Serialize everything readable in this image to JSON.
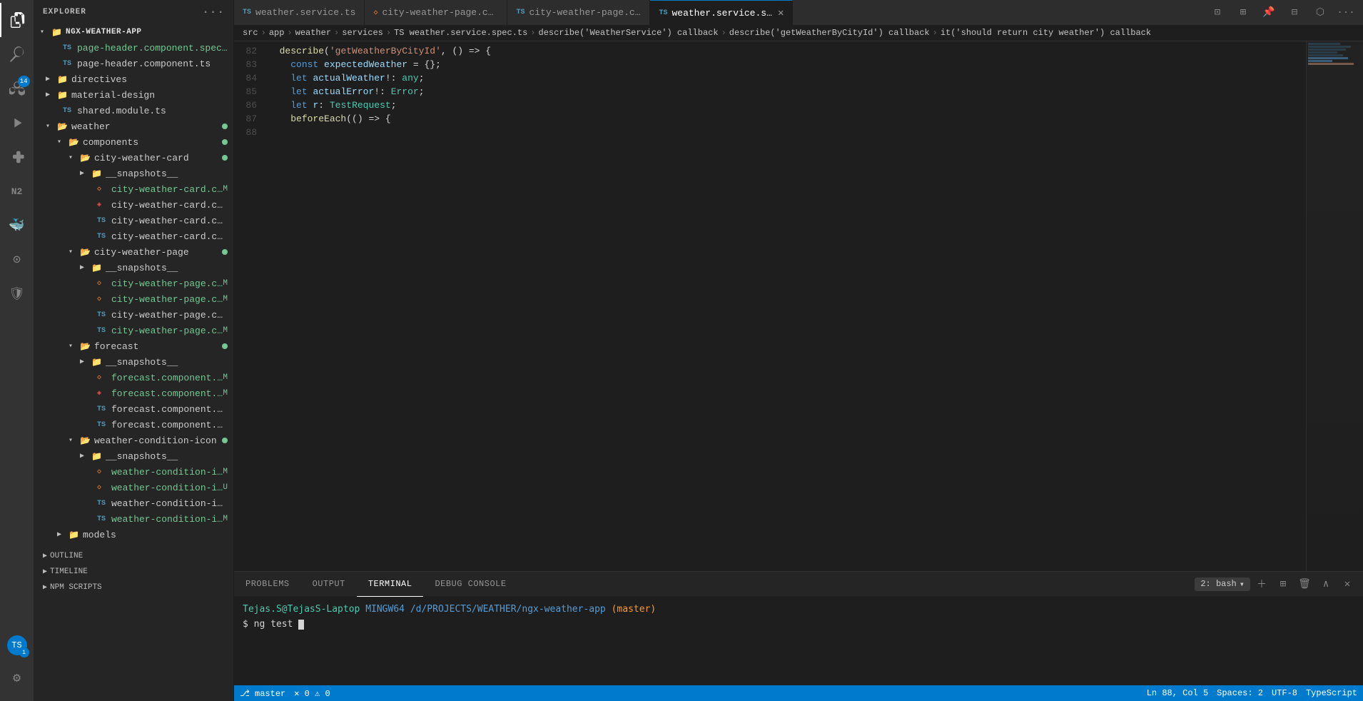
{
  "activityBar": {
    "icons": [
      {
        "id": "explorer",
        "symbol": "⬜",
        "active": true,
        "badge": null
      },
      {
        "id": "search",
        "symbol": "🔍",
        "active": false,
        "badge": null
      },
      {
        "id": "source-control",
        "symbol": "⑂",
        "active": false,
        "badge": "14"
      },
      {
        "id": "run",
        "symbol": "▷",
        "active": false,
        "badge": null
      },
      {
        "id": "extensions",
        "symbol": "⊞",
        "active": false,
        "badge": null
      },
      {
        "id": "n2",
        "symbol": "N₂",
        "active": false,
        "badge": null
      },
      {
        "id": "docker",
        "symbol": "🐳",
        "active": false,
        "badge": null
      },
      {
        "id": "remote",
        "symbol": "⊙",
        "active": false,
        "badge": null
      },
      {
        "id": "shield",
        "symbol": "🛡",
        "active": false,
        "badge": null
      }
    ],
    "avatar": {
      "initials": "TS",
      "badge": "1"
    }
  },
  "sidebar": {
    "title": "EXPLORER",
    "sections": {
      "outline": "OUTLINE",
      "timeline": "TIMELINE",
      "npmScripts": "NPM SCRIPTS"
    }
  },
  "fileTree": {
    "rootName": "NGX-WEATHER-APP",
    "items": [
      {
        "id": "page-header-spec",
        "indent": 1,
        "type": "file",
        "icon": "ts",
        "label": "page-header.component.spec...",
        "badge": ""
      },
      {
        "id": "page-header-ts",
        "indent": 1,
        "type": "file",
        "icon": "ts",
        "label": "page-header.component.ts",
        "badge": ""
      },
      {
        "id": "directives",
        "indent": 1,
        "type": "folder",
        "icon": "",
        "label": "directives",
        "badge": ""
      },
      {
        "id": "material-design",
        "indent": 1,
        "type": "folder",
        "icon": "",
        "label": "material-design",
        "badge": ""
      },
      {
        "id": "shared-module",
        "indent": 1,
        "type": "file",
        "icon": "ts",
        "label": "shared.module.ts",
        "badge": ""
      },
      {
        "id": "weather-folder",
        "indent": 1,
        "type": "folder-open",
        "icon": "",
        "label": "weather",
        "badge": "dot"
      },
      {
        "id": "components",
        "indent": 2,
        "type": "folder-open",
        "icon": "",
        "label": "components",
        "badge": "dot"
      },
      {
        "id": "city-weather-card",
        "indent": 3,
        "type": "folder-open",
        "icon": "",
        "label": "city-weather-card",
        "badge": "dot"
      },
      {
        "id": "snapshots-1",
        "indent": 4,
        "type": "folder",
        "icon": "",
        "label": "__snapshots__",
        "badge": ""
      },
      {
        "id": "cwc-html",
        "indent": 4,
        "type": "file",
        "icon": "html",
        "label": "city-weather-card.component...",
        "badge": "M"
      },
      {
        "id": "cwc-scss",
        "indent": 4,
        "type": "file",
        "icon": "scss",
        "label": "city-weather-card.component.scss",
        "badge": ""
      },
      {
        "id": "cwc-spec",
        "indent": 4,
        "type": "file",
        "icon": "ts",
        "label": "city-weather-card.component.spec...",
        "badge": ""
      },
      {
        "id": "cwc-ts",
        "indent": 4,
        "type": "file",
        "icon": "ts",
        "label": "city-weather-card.component.ts",
        "badge": ""
      },
      {
        "id": "city-weather-page",
        "indent": 3,
        "type": "folder-open",
        "icon": "",
        "label": "city-weather-page",
        "badge": "dot"
      },
      {
        "id": "snapshots-2",
        "indent": 4,
        "type": "folder",
        "icon": "",
        "label": "__snapshots__",
        "badge": ""
      },
      {
        "id": "cwp-html",
        "indent": 4,
        "type": "file",
        "icon": "html",
        "label": "city-weather-page.compone...",
        "badge": "M"
      },
      {
        "id": "cwp-scss",
        "indent": 4,
        "type": "file",
        "icon": "html",
        "label": "city-weather-page.compone...",
        "badge": "M"
      },
      {
        "id": "cwp-spec",
        "indent": 4,
        "type": "file",
        "icon": "ts",
        "label": "city-weather-page.component.spe...",
        "badge": ""
      },
      {
        "id": "cwp-ts",
        "indent": 4,
        "type": "file",
        "icon": "ts",
        "label": "city-weather-page.compone...",
        "badge": "M"
      },
      {
        "id": "forecast",
        "indent": 3,
        "type": "folder-open",
        "icon": "",
        "label": "forecast",
        "badge": "dot"
      },
      {
        "id": "snapshots-3",
        "indent": 4,
        "type": "folder",
        "icon": "",
        "label": "__snapshots__",
        "badge": ""
      },
      {
        "id": "forecast-html",
        "indent": 4,
        "type": "file",
        "icon": "html",
        "label": "forecast.component.html",
        "badge": "M"
      },
      {
        "id": "forecast-scss",
        "indent": 4,
        "type": "file",
        "icon": "scss",
        "label": "forecast.component.scss",
        "badge": "M"
      },
      {
        "id": "forecast-spec",
        "indent": 4,
        "type": "file",
        "icon": "ts",
        "label": "forecast.component.spec.ts",
        "badge": ""
      },
      {
        "id": "forecast-ts",
        "indent": 4,
        "type": "file",
        "icon": "ts",
        "label": "forecast.component.ts",
        "badge": ""
      },
      {
        "id": "weather-condition-icon",
        "indent": 3,
        "type": "folder-open",
        "icon": "",
        "label": "weather-condition-icon",
        "badge": "dot"
      },
      {
        "id": "snapshots-4",
        "indent": 4,
        "type": "folder",
        "icon": "",
        "label": "__snapshots__",
        "badge": ""
      },
      {
        "id": "wci-html",
        "indent": 4,
        "type": "file",
        "icon": "html",
        "label": "weather-condition-icon.com...",
        "badge": "M"
      },
      {
        "id": "wci-scss",
        "indent": 4,
        "type": "file",
        "icon": "html",
        "label": "weather-condition-icon.comp...",
        "badge": "U"
      },
      {
        "id": "wci-spec",
        "indent": 4,
        "type": "file",
        "icon": "ts",
        "label": "weather-condition-icon.componen...",
        "badge": ""
      },
      {
        "id": "wci-ts",
        "indent": 4,
        "type": "file",
        "icon": "ts",
        "label": "weather-condition-icon.com...",
        "badge": "M"
      },
      {
        "id": "models",
        "indent": 2,
        "type": "folder",
        "icon": "",
        "label": "models",
        "badge": ""
      }
    ]
  },
  "tabs": [
    {
      "id": "weather-service-ts",
      "label": "weather.service.ts",
      "icon": "ts",
      "active": false,
      "dirty": false
    },
    {
      "id": "city-weather-page-html",
      "label": "city-weather-page.component.html",
      "icon": "html",
      "active": false,
      "dirty": false
    },
    {
      "id": "city-weather-page-spec",
      "label": "city-weather-page.component.spec.ts",
      "icon": "ts",
      "active": false,
      "dirty": false
    },
    {
      "id": "weather-service-spec",
      "label": "weather.service.spec.ts",
      "icon": "ts",
      "active": true,
      "dirty": false
    }
  ],
  "breadcrumb": {
    "parts": [
      "src",
      "app",
      "weather",
      "services",
      "TS weather.service.spec.ts",
      "describe('WeatherService') callback",
      "describe('getWeatherByCityId') callback",
      "it('should return city weather') callback"
    ]
  },
  "codeLines": [
    {
      "num": 82,
      "content": "  describe('getWeatherByCityId', () => {"
    },
    {
      "num": 83,
      "content": "    const expectedWeather = {};"
    },
    {
      "num": 84,
      "content": "    let actualWeather!: any;"
    },
    {
      "num": 85,
      "content": "    let actualError!: Error;"
    },
    {
      "num": 86,
      "content": "    let r: TestRequest;"
    },
    {
      "num": 87,
      "content": ""
    },
    {
      "num": 88,
      "content": "    beforeEach(() => {"
    }
  ],
  "terminal": {
    "title": "TERMINAL",
    "selectedShell": "2: bash",
    "prompt": {
      "user": "Tejas.S@TejasS-Laptop",
      "env": "MINGW64",
      "path": "/d/PROJECTS/WEATHER/ngx-weather-app",
      "branch": "(master)"
    },
    "command": "ng test"
  },
  "panelTabs": [
    {
      "id": "problems",
      "label": "PROBLEMS",
      "active": false
    },
    {
      "id": "output",
      "label": "OUTPUT",
      "active": false
    },
    {
      "id": "terminal",
      "label": "TERMINAL",
      "active": true
    },
    {
      "id": "debug-console",
      "label": "DEBUG CONSOLE",
      "active": false
    }
  ],
  "statusBar": {
    "left": [
      "⎇ master",
      "✕ 0  ⚠ 0"
    ],
    "right": [
      "Ln 88, Col 5",
      "Spaces: 2",
      "UTF-8",
      "TypeScript"
    ]
  }
}
